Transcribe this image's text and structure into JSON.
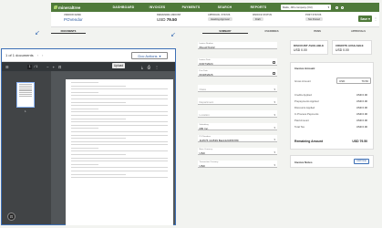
{
  "app": {
    "logo_text": "mineraltree",
    "nav": [
      "DASHBOARD",
      "INVOICES",
      "PAYMENTS",
      "SEARCH",
      "REPORTS"
    ],
    "company": "Mattu, Jill's company (OU)"
  },
  "header": {
    "vendor_label": "VENDOR NAME",
    "vendor_value": "POVendor",
    "remaining_label": "REMAINING AMOUNT",
    "remaining_currency": "USD",
    "remaining_value": "79.50",
    "approval_label": "APPROVAL STATUS",
    "approval_value": "Awaiting Approval",
    "invoice_status_label": "INVOICE STATUS",
    "invoice_status_value": "Draft",
    "post_status_label": "POST STATUS",
    "post_status_value": "Not Posted",
    "save_label": "Save"
  },
  "tabs": [
    "DOCUMENTS",
    "SUMMARY",
    "OVERRIDES",
    "ITEMS",
    "APPROVALS"
  ],
  "viewer": {
    "doc_count": "1 of 1 documents",
    "doc_actions": "Doc Actions",
    "page_current": "1",
    "page_total": "/ 1",
    "tooltip": "Upload",
    "thumb_page": "1"
  },
  "form": {
    "fields": [
      {
        "label": "Invoice Number",
        "value": "6Noo071222"
      },
      {
        "label": "Invoice Date",
        "value": "03/07/2024"
      },
      {
        "label": "Due Date",
        "value": "06/28/2026"
      },
      {
        "label": "",
        "value": "",
        "placeholder": "Class"
      },
      {
        "label": "",
        "value": "",
        "placeholder": "Department"
      },
      {
        "label": "",
        "value": "",
        "placeholder": "Location"
      },
      {
        "label": "Subsidiary",
        "value": "MR Inc."
      },
      {
        "label": "PO Numbers",
        "value": "114576 114539 Bank123456789"
      },
      {
        "label": "Base Currency",
        "value": "USD"
      },
      {
        "label": "Transaction Currency",
        "value": "USD"
      }
    ]
  },
  "discount": {
    "label": "DISCOUNT AVAILABLE",
    "value": "USD  0.00"
  },
  "credits": {
    "label": "CREDITS AVAILABLE",
    "value": "USD  0.00"
  },
  "invoice_amount": {
    "title": "Invoice Amount",
    "gross_label": "Gross Amount",
    "gross_currency": "USD",
    "gross_value": "79.50",
    "rows": [
      {
        "label": "Credits Applied",
        "value": "USD  0.00"
      },
      {
        "label": "Prepayments Applied",
        "value": "USD  0.00"
      },
      {
        "label": "Discounts Applied",
        "value": "USD  0.00"
      },
      {
        "label": "In Process Payments",
        "value": "USD  0.00"
      },
      {
        "label": "Paid Amount",
        "value": "USD  0.00"
      },
      {
        "label": "Total Tax",
        "value": "USD  0.00"
      }
    ],
    "remaining_label": "Remaining Amount",
    "remaining_value": "USD  79.50"
  },
  "notes": {
    "title": "Invoice Notes",
    "add_label": "Add Note"
  }
}
